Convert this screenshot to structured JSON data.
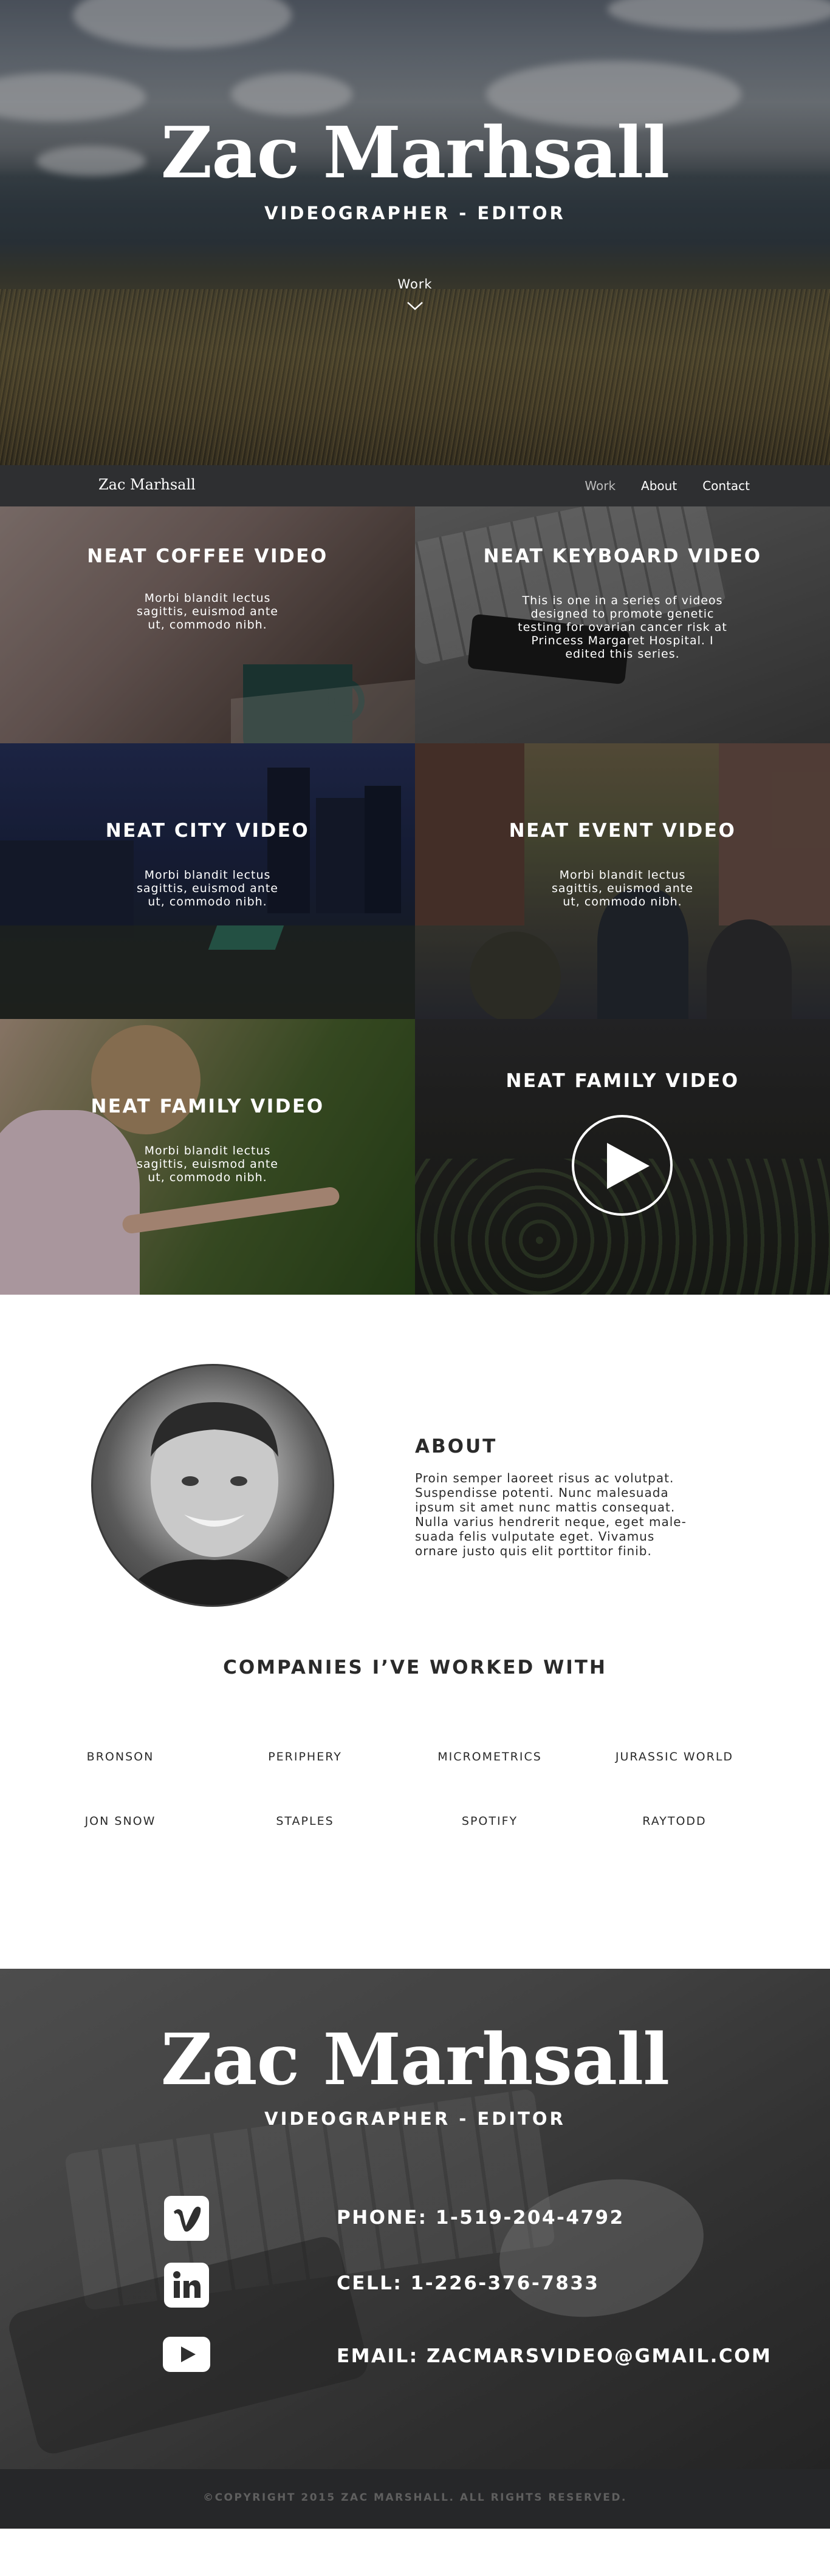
{
  "hero": {
    "title": "Zac Marhsall",
    "subtitle": "VIDEOGRAPHER - EDITOR",
    "work_link": "Work",
    "chevron_icon": "chevron-down-icon"
  },
  "nav": {
    "brand": "Zac Marhsall",
    "links": [
      "Work",
      "About",
      "Contact"
    ],
    "active": "Work"
  },
  "projects": [
    {
      "title": "NEAT COFFEE VIDEO",
      "lines": [
        "Morbi blandit lectus",
        "sagittis, euismod ante",
        "ut, commodo nibh."
      ]
    },
    {
      "title": "NEAT KEYBOARD VIDEO",
      "lines": [
        "This is one in a series of videos",
        "designed to promote genetic",
        "testing for ovarian cancer risk at",
        "Princess Margaret Hospital. I",
        "edited this series."
      ]
    },
    {
      "title": "NEAT CITY VIDEO",
      "lines": [
        "Morbi blandit lectus",
        "sagittis, euismod ante",
        "ut, commodo nibh."
      ]
    },
    {
      "title": "NEAT EVENT VIDEO",
      "lines": [
        "Morbi blandit lectus",
        "sagittis, euismod ante",
        "ut, commodo nibh."
      ]
    },
    {
      "title": "NEAT FAMILY VIDEO",
      "lines": [
        "Morbi blandit lectus",
        "sagittis, euismod ante",
        "ut, commodo nibh."
      ]
    },
    {
      "title": "NEAT FAMILY VIDEO",
      "play_icon": "play-icon"
    }
  ],
  "about": {
    "heading": "ABOUT",
    "lines": [
      "Proin semper laoreet risus ac volutpat.",
      "Suspendisse potenti. Nunc malesuada",
      "ipsum sit amet nunc mattis consequat.",
      "Nulla varius hendrerit neque, eget male-",
      "suada felis vulputate eget. Vivamus",
      "ornare justo quis elit porttitor finib."
    ]
  },
  "companies": {
    "heading": "COMPANIES I’VE WORKED WITH",
    "row1": [
      "BRONSON",
      "PERIPHERY",
      "MICROMETRICS",
      "JURASSIC WORLD"
    ],
    "row2": [
      "JON SNOW",
      "STAPLES",
      "SPOTIFY",
      "RAYTODD"
    ]
  },
  "contact": {
    "title": "Zac Marhsall",
    "subtitle": "VIDEOGRAPHER - EDITOR",
    "phone": "PHONE: 1-519-204-4792",
    "cell": "CELL: 1-226-376-7833",
    "email": "EMAIL: ZACMARSVIDEO@GMAIL.COM",
    "icons": [
      "vimeo-icon",
      "linkedin-icon",
      "youtube-icon"
    ]
  },
  "footer": {
    "copyright": "©COPYRIGHT 2015 ZAC MARSHALL. ALL RIGHTS RESERVED."
  }
}
